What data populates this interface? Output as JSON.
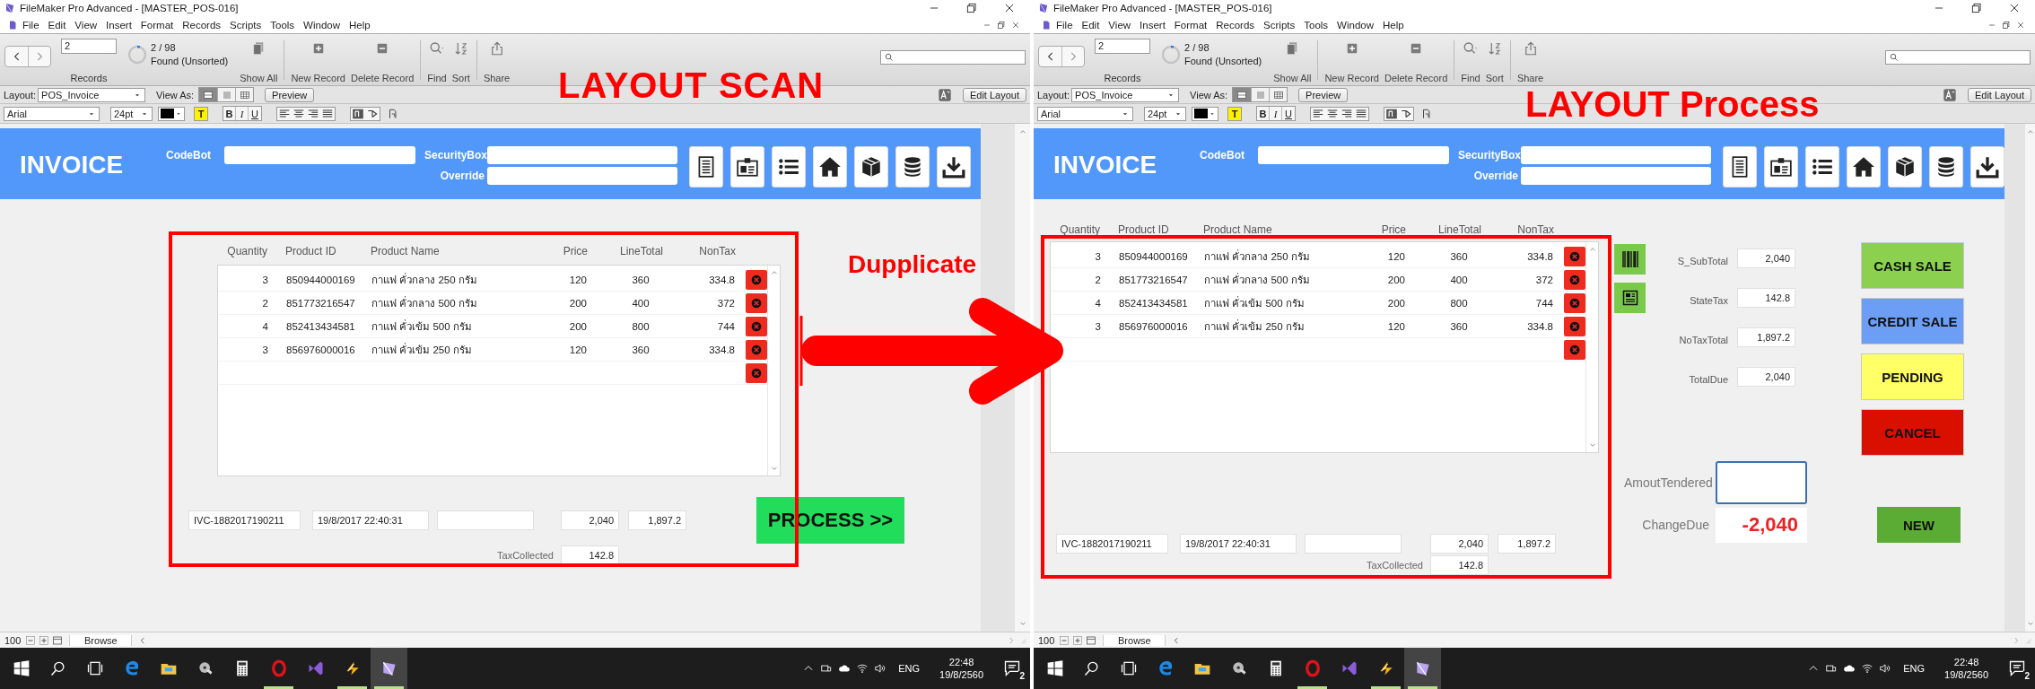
{
  "windows": [
    {
      "kind": "scan",
      "title": "FileMaker Pro Advanced - [MASTER_POS-016]",
      "menu": [
        "File",
        "Edit",
        "View",
        "Insert",
        "Format",
        "Records",
        "Scripts",
        "Tools",
        "Window",
        "Help"
      ],
      "toolbar": {
        "record": "2",
        "records_label": "Records",
        "found_count": "2 / 98",
        "found_state": "Found (Unsorted)",
        "actions": [
          {
            "kind": "show-all",
            "label": "Show All"
          },
          {
            "kind": "new",
            "label": "New Record"
          },
          {
            "kind": "delete",
            "label": "Delete Record"
          },
          {
            "kind": "find",
            "label": "Find"
          },
          {
            "kind": "sort",
            "label": "Sort"
          },
          {
            "kind": "share",
            "label": "Share"
          }
        ]
      },
      "layout_bar": {
        "layout_label": "Layout:",
        "layout": "POS_Invoice",
        "view_as_label": "View As:",
        "view_modes": [
          {
            "selected": true
          },
          {
            "selected": false
          },
          {
            "selected": false
          }
        ],
        "preview": "Preview",
        "edit_layout": "Edit Layout"
      },
      "format_bar": {
        "font": "Arial",
        "size": "24pt",
        "highlight": "T",
        "styles": [
          "B",
          "I",
          "U"
        ]
      },
      "invoice": {
        "title": "INVOICE",
        "fields": [
          {
            "label": "CodeBot"
          },
          {
            "label": "SecurityBox"
          },
          {
            "label": "Override"
          }
        ]
      },
      "columns": [
        "Quantity",
        "Product ID",
        "Product Name",
        "Price",
        "LineTotal",
        "NonTax"
      ],
      "rows": [
        {
          "quantity": "3",
          "product_id": "850944000169",
          "name": "กาแฟ คั่วกลาง 250 กรัม",
          "price": "120",
          "line_total": "360",
          "non_tax": "334.8"
        },
        {
          "quantity": "2",
          "product_id": "851773216547",
          "name": "กาแฟ คั่วกลาง 500 กรัม",
          "price": "200",
          "line_total": "400",
          "non_tax": "372"
        },
        {
          "quantity": "4",
          "product_id": "852413434581",
          "name": "กาแฟ คั่วเข้ม 500 กรัม",
          "price": "200",
          "line_total": "800",
          "non_tax": "744"
        },
        {
          "quantity": "3",
          "product_id": "856976000016",
          "name": "กาแฟ คั่วเข้ม 250 กรัม",
          "price": "120",
          "line_total": "360",
          "non_tax": "334.8"
        }
      ],
      "footer": {
        "invoice_no": "IVC-1882017190211",
        "datetime": "19/8/2017 22:40:31",
        "total": "2,040",
        "non_tax_total": "1,897.2",
        "tax_label": "TaxCollected",
        "tax": "142.8"
      },
      "process_button": "PROCESS >>",
      "status_bar": {
        "zoom": "100",
        "mode": "Browse"
      },
      "taskbar": {
        "apps": [
          {
            "kind": "browser",
            "running": false,
            "selected": false
          },
          {
            "kind": "folder",
            "running": false,
            "selected": false
          },
          {
            "kind": "disc",
            "running": false,
            "selected": false
          },
          {
            "kind": "calculator",
            "running": false,
            "selected": false
          },
          {
            "kind": "ring",
            "running": true,
            "selected": false
          },
          {
            "kind": "bowtie",
            "running": false,
            "selected": false
          },
          {
            "kind": "bolt",
            "running": true,
            "selected": false
          },
          {
            "kind": "prism",
            "running": true,
            "selected": true
          }
        ],
        "language": "ENG",
        "time": "22:48",
        "date": "19/8/2560",
        "notifications": "2"
      }
    },
    {
      "kind": "process",
      "title": "FileMaker Pro Advanced - [MASTER_POS-016]",
      "menu": [
        "File",
        "Edit",
        "View",
        "Insert",
        "Format",
        "Records",
        "Scripts",
        "Tools",
        "Window",
        "Help"
      ],
      "toolbar": {
        "record": "2",
        "records_label": "Records",
        "found_count": "2 / 98",
        "found_state": "Found (Unsorted)",
        "actions": [
          {
            "kind": "show-all",
            "label": "Show All"
          },
          {
            "kind": "new",
            "label": "New Record"
          },
          {
            "kind": "delete",
            "label": "Delete Record"
          },
          {
            "kind": "find",
            "label": "Find"
          },
          {
            "kind": "sort",
            "label": "Sort"
          },
          {
            "kind": "share",
            "label": "Share"
          }
        ]
      },
      "layout_bar": {
        "layout_label": "Layout:",
        "layout": "POS_Invoice",
        "view_as_label": "View As:",
        "view_modes": [
          {
            "selected": true
          },
          {
            "selected": false
          },
          {
            "selected": false
          }
        ],
        "preview": "Preview",
        "edit_layout": "Edit Layout"
      },
      "format_bar": {
        "font": "Arial",
        "size": "24pt",
        "highlight": "T",
        "styles": [
          "B",
          "I",
          "U"
        ]
      },
      "invoice": {
        "title": "INVOICE",
        "fields": [
          {
            "label": "CodeBot"
          },
          {
            "label": "SecurityBox"
          },
          {
            "label": "Override"
          }
        ]
      },
      "columns": [
        "Quantity",
        "Product ID",
        "Product Name",
        "Price",
        "LineTotal",
        "NonTax"
      ],
      "rows": [
        {
          "quantity": "3",
          "product_id": "850944000169",
          "name": "กาแฟ คั่วกลาง 250 กรัม",
          "price": "120",
          "line_total": "360",
          "non_tax": "334.8"
        },
        {
          "quantity": "2",
          "product_id": "851773216547",
          "name": "กาแฟ คั่วกลาง 500 กรัม",
          "price": "200",
          "line_total": "400",
          "non_tax": "372"
        },
        {
          "quantity": "4",
          "product_id": "852413434581",
          "name": "กาแฟ คั่วเข้ม 500 กรัม",
          "price": "200",
          "line_total": "800",
          "non_tax": "744"
        },
        {
          "quantity": "3",
          "product_id": "856976000016",
          "name": "กาแฟ คั่วเข้ม 250 กรัม",
          "price": "120",
          "line_total": "360",
          "non_tax": "334.8"
        }
      ],
      "footer": {
        "invoice_no": "IVC-1882017190211",
        "datetime": "19/8/2017 22:40:31",
        "total": "2,040",
        "non_tax_total": "1,897.2",
        "tax_label": "TaxCollected",
        "tax": "142.8"
      },
      "summary": [
        {
          "label": "S_SubTotal",
          "value": "2,040"
        },
        {
          "label": "StateTax",
          "value": "142.8"
        },
        {
          "label": "NoTaxTotal",
          "value": "1,897.2"
        },
        {
          "label": "TotalDue",
          "value": "2,040"
        }
      ],
      "actions": [
        {
          "label": "CASH SALE",
          "color": "#8bd14f"
        },
        {
          "label": "CREDIT SALE",
          "color": "#6d9ef5"
        },
        {
          "label": "PENDING",
          "color": "#ffff66"
        },
        {
          "label": "CANCEL",
          "color": "#d90f00"
        }
      ],
      "tendered_label": "AmoutTendered",
      "change_label": "ChangeDue",
      "change_due": "-2,040",
      "new_button": "NEW",
      "status_bar": {
        "zoom": "100",
        "mode": "Browse"
      },
      "taskbar": {
        "apps": [
          {
            "kind": "browser",
            "running": false,
            "selected": false
          },
          {
            "kind": "folder",
            "running": false,
            "selected": false
          },
          {
            "kind": "disc",
            "running": false,
            "selected": false
          },
          {
            "kind": "calculator",
            "running": false,
            "selected": false
          },
          {
            "kind": "ring",
            "running": true,
            "selected": false
          },
          {
            "kind": "bowtie",
            "running": false,
            "selected": false
          },
          {
            "kind": "bolt",
            "running": true,
            "selected": false
          },
          {
            "kind": "prism",
            "running": true,
            "selected": true
          }
        ],
        "language": "ENG",
        "time": "22:48",
        "date": "19/8/2560",
        "notifications": "2"
      }
    }
  ],
  "annotations": {
    "scan_title": "LAYOUT SCAN",
    "arrow_label": "Dupplicate",
    "process_title": "LAYOUT Process"
  }
}
